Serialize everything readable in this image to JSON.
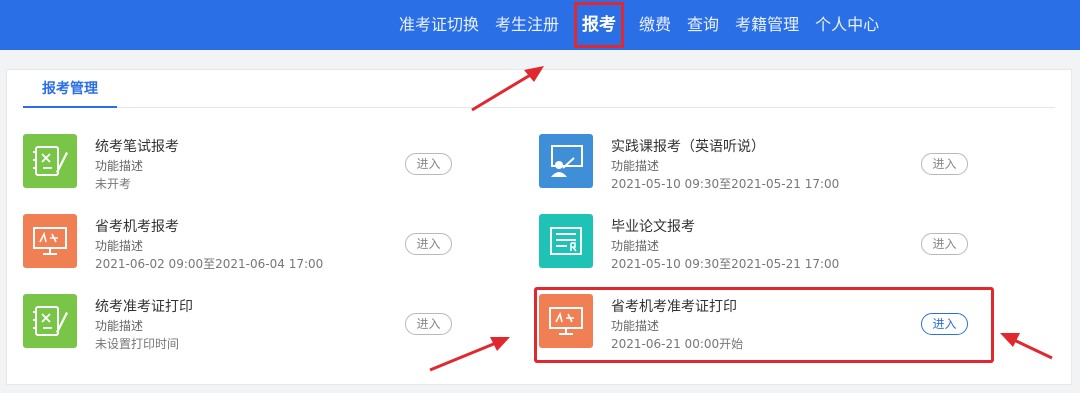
{
  "nav": {
    "items": [
      "准考证切换",
      "考生注册",
      "报考",
      "缴费",
      "查询",
      "考籍管理",
      "个人中心"
    ],
    "active": "报考"
  },
  "tab": {
    "label": "报考管理"
  },
  "enter_label": "进入",
  "items": [
    {
      "title": "统考笔试报考",
      "desc": "功能描述",
      "meta": "未开考",
      "icon": "notebook-icon",
      "color": "#79c547"
    },
    {
      "title": "实践课报考（英语听说）",
      "desc": "功能描述",
      "meta": "2021-05-10 09:30至2021-05-21 17:00",
      "icon": "teacher-board-icon",
      "color": "#3e8fd8"
    },
    {
      "title": "省考机考报考",
      "desc": "功能描述",
      "meta": "2021-06-02 09:00至2021-06-04 17:00",
      "icon": "monitor-exam-icon",
      "color": "#f07f54"
    },
    {
      "title": "毕业论文报考",
      "desc": "功能描述",
      "meta": "2021-05-10 09:30至2021-05-21 17:00",
      "icon": "certificate-icon",
      "color": "#1fc3b6"
    },
    {
      "title": "统考准考证打印",
      "desc": "功能描述",
      "meta": "未设置打印时间",
      "icon": "notebook-icon",
      "color": "#79c547"
    },
    {
      "title": "省考机考准考证打印",
      "desc": "功能描述",
      "meta": "2021-06-21 00:00开始",
      "icon": "monitor-exam-icon",
      "color": "#f07f54"
    }
  ]
}
